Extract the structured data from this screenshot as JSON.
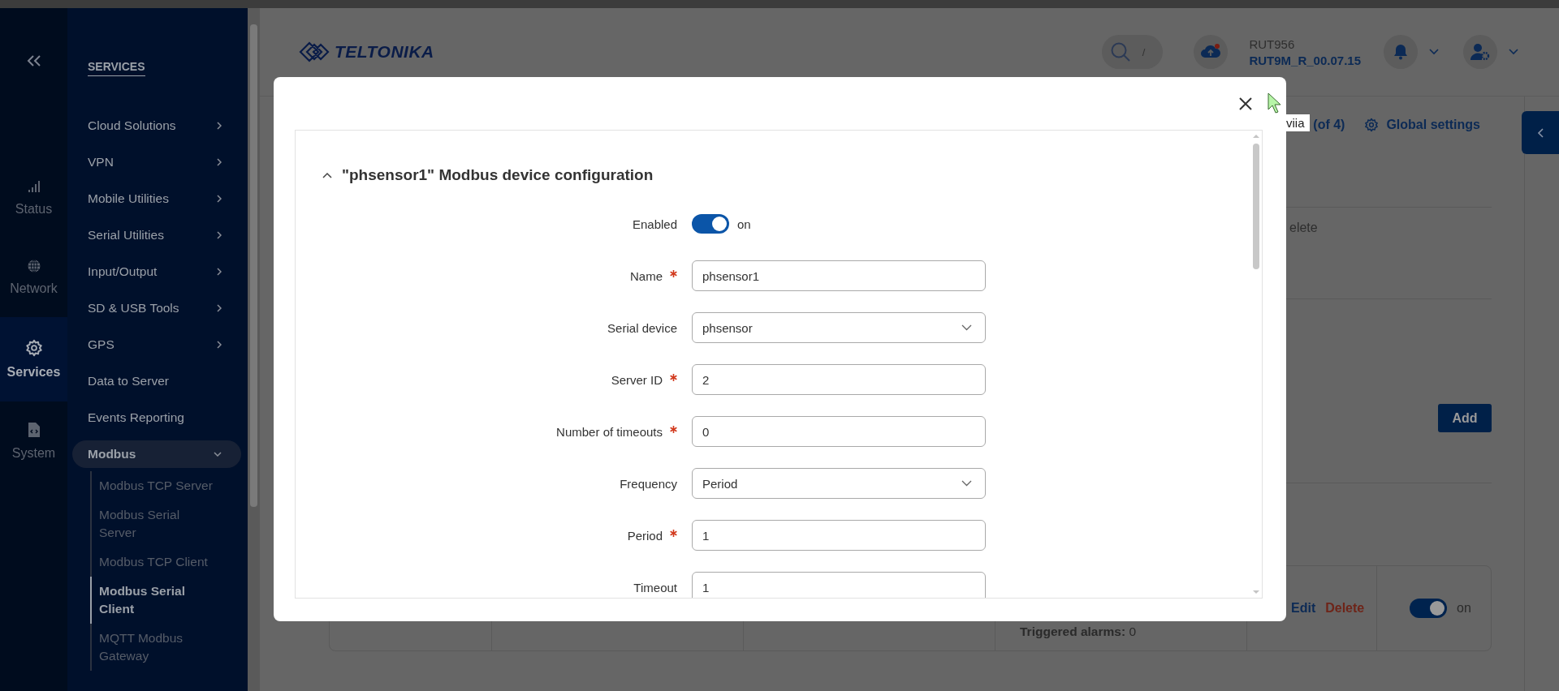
{
  "rail": {
    "items": [
      {
        "label": "Status",
        "selected": false
      },
      {
        "label": "Network",
        "selected": false
      },
      {
        "label": "Services",
        "selected": true
      },
      {
        "label": "System",
        "selected": false
      }
    ]
  },
  "sidebar": {
    "heading": "SERVICES",
    "items": [
      {
        "label": "Cloud Solutions",
        "expandable": true,
        "expanded": false
      },
      {
        "label": "VPN",
        "expandable": true,
        "expanded": false
      },
      {
        "label": "Mobile Utilities",
        "expandable": true,
        "expanded": false
      },
      {
        "label": "Serial Utilities",
        "expandable": true,
        "expanded": false
      },
      {
        "label": "Input/Output",
        "expandable": true,
        "expanded": false
      },
      {
        "label": "SD & USB Tools",
        "expandable": true,
        "expanded": false
      },
      {
        "label": "GPS",
        "expandable": true,
        "expanded": false
      },
      {
        "label": "Data to Server",
        "expandable": false,
        "expanded": false
      },
      {
        "label": "Events Reporting",
        "expandable": false,
        "expanded": false
      },
      {
        "label": "Modbus",
        "expandable": true,
        "expanded": true,
        "children": [
          {
            "label": "Modbus TCP Server",
            "selected": false
          },
          {
            "label": "Modbus Serial Server",
            "selected": false
          },
          {
            "label": "Modbus TCP Client",
            "selected": false
          },
          {
            "label": "Modbus Serial Client",
            "selected": true
          },
          {
            "label": "MQTT Modbus Gateway",
            "selected": false
          }
        ]
      }
    ]
  },
  "header": {
    "logo": "TELTONIKA",
    "search_shortcut": "/",
    "device_model": "RUT956",
    "firmware": "RUT9M_R_00.07.15"
  },
  "background": {
    "tooltip": "viia",
    "pager": "(of 4)",
    "global_settings": "Global settings",
    "cut_text": "elete",
    "add_button": "Add",
    "row": {
      "triggered": "**Triggered alarms:** 0",
      "edit": "Edit",
      "delete": "Delete",
      "enabled": true,
      "enabled_label": "on"
    }
  },
  "modal": {
    "title": "\"phsensor1\" Modbus device configuration",
    "expanded": true,
    "fields": [
      {
        "kind": "toggle",
        "label": "Enabled",
        "required": false,
        "on": true,
        "state_label": "on"
      },
      {
        "kind": "text",
        "label": "Name",
        "required": true,
        "value": "phsensor1"
      },
      {
        "kind": "select",
        "label": "Serial device",
        "required": false,
        "value": "phsensor"
      },
      {
        "kind": "text",
        "label": "Server ID",
        "required": true,
        "value": "2"
      },
      {
        "kind": "text",
        "label": "Number of timeouts",
        "required": true,
        "value": "0"
      },
      {
        "kind": "select",
        "label": "Frequency",
        "required": false,
        "value": "Period"
      },
      {
        "kind": "text",
        "label": "Period",
        "required": true,
        "value": "1"
      },
      {
        "kind": "text",
        "label": "Timeout",
        "required": false,
        "value": "1"
      }
    ]
  }
}
